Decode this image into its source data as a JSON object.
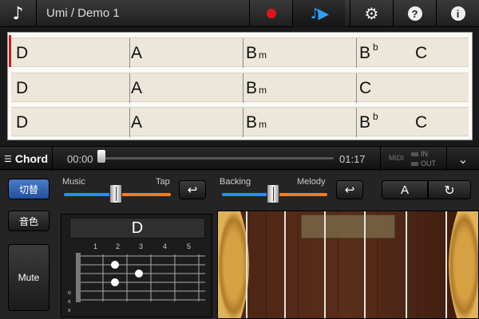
{
  "header": {
    "app_icon": "music-note-icon",
    "song_title": "Umi / Demo 1",
    "buttons": [
      "record-icon",
      "play-icon",
      "gear-icon",
      "help-icon",
      "info-icon"
    ]
  },
  "chord_sheet": {
    "rows": [
      {
        "measures": [
          {
            "root": "D",
            "sfx": "",
            "sup": ""
          },
          {
            "root": "A",
            "sfx": "",
            "sup": ""
          },
          {
            "root": "B",
            "sfx": "m",
            "sup": ""
          },
          {
            "root": "B",
            "sfx": "",
            "sup": "b"
          },
          {
            "root": "C",
            "sfx": "",
            "sup": ""
          }
        ]
      },
      {
        "measures": [
          {
            "root": "D",
            "sfx": "",
            "sup": ""
          },
          {
            "root": "A",
            "sfx": "",
            "sup": ""
          },
          {
            "root": "B",
            "sfx": "m",
            "sup": ""
          },
          {
            "root": "C",
            "sfx": "",
            "sup": ""
          }
        ]
      },
      {
        "measures": [
          {
            "root": "D",
            "sfx": "",
            "sup": ""
          },
          {
            "root": "A",
            "sfx": "",
            "sup": ""
          },
          {
            "root": "B",
            "sfx": "m",
            "sup": ""
          },
          {
            "root": "B",
            "sfx": "",
            "sup": "b"
          },
          {
            "root": "C",
            "sfx": "",
            "sup": ""
          }
        ]
      }
    ]
  },
  "transport": {
    "mode_label": "Chord",
    "time_current": "00:00",
    "time_total": "01:17",
    "midi_label": "MIDI",
    "midi_in": "IN",
    "midi_out": "OUT"
  },
  "controls": {
    "switch_label": "切替",
    "tone_label": "音色",
    "mute_label": "Mute",
    "music_label": "Music",
    "tap_label": "Tap",
    "backing_label": "Backing",
    "melody_label": "Melody",
    "key_label": "A",
    "colors": {
      "blue": "#2a8cff",
      "orange": "#ff7a1a"
    }
  },
  "chord_diagram": {
    "chord_name": "D",
    "fret_numbers": [
      "1",
      "2",
      "3",
      "4",
      "5"
    ],
    "string_marks": [
      "o",
      "x",
      "x"
    ]
  }
}
